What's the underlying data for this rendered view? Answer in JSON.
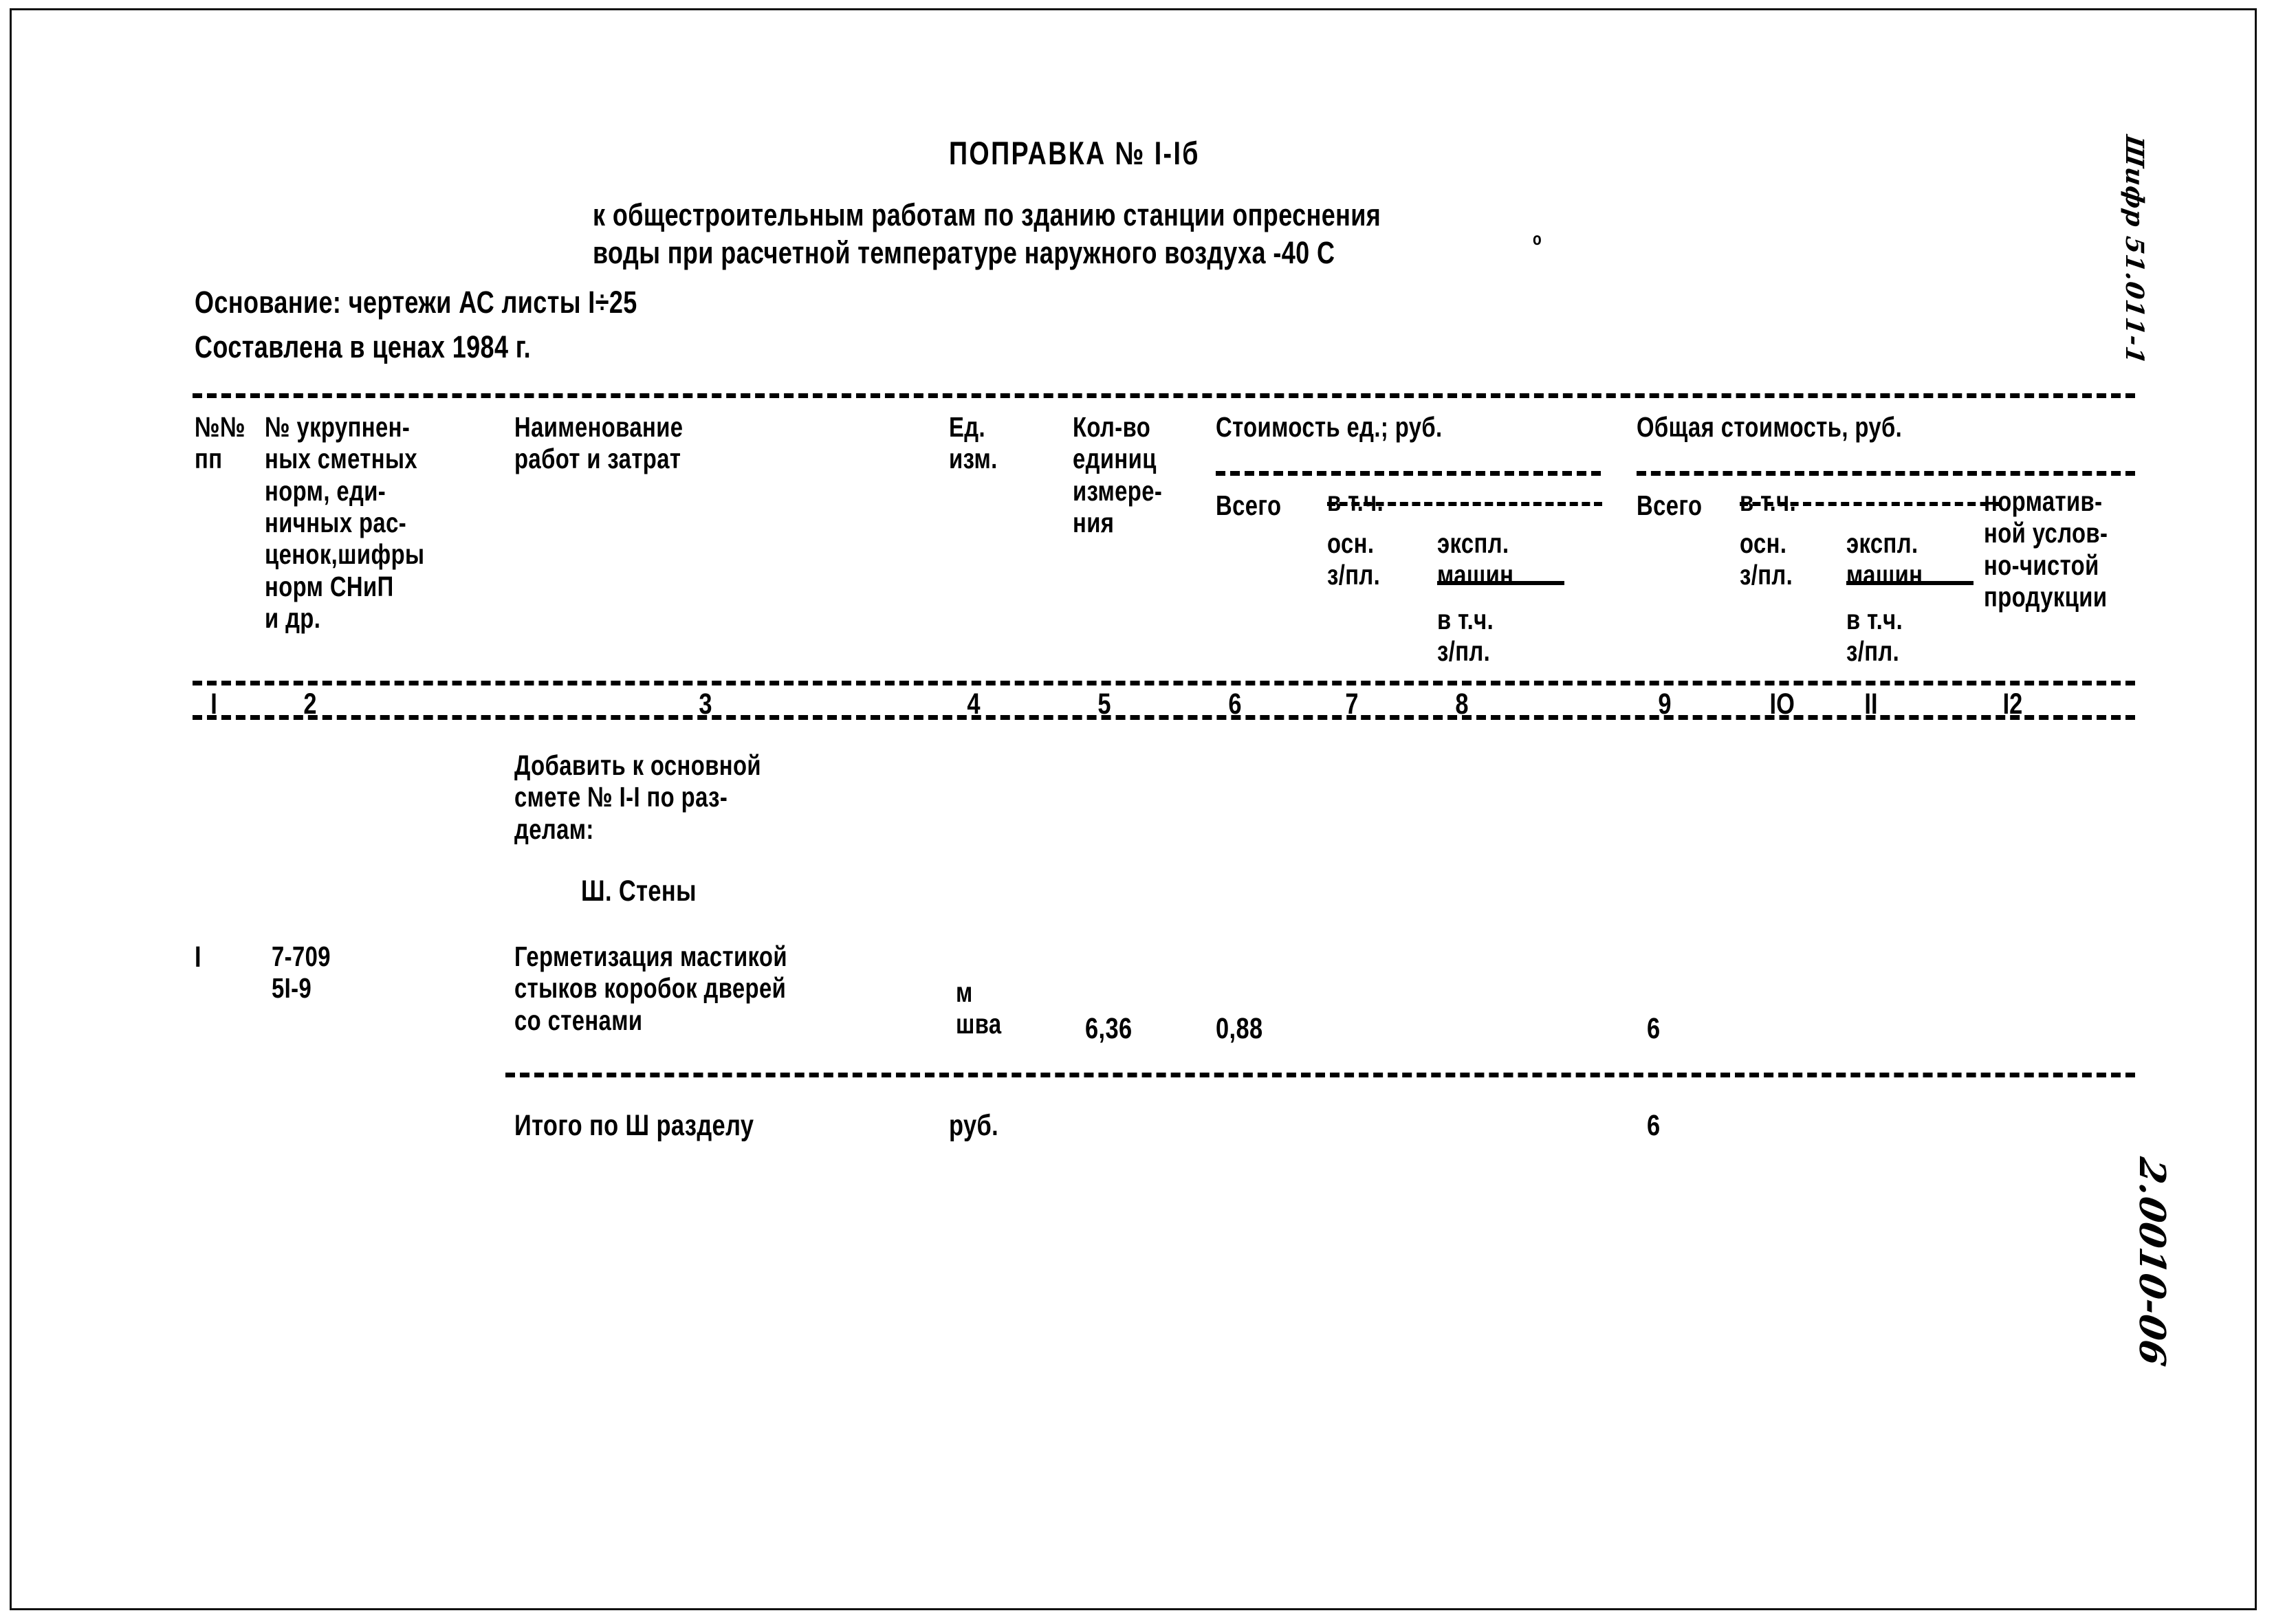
{
  "document": {
    "title": "ПОПРАВКА № I-Iб",
    "subtitle_line_1": "к общестроительным работам по зданию станции опреснения",
    "subtitle_line_2": "воды при расчетной температуре наружного воздуха -40 С",
    "degree_symbol": "о",
    "basis": "Основание: чертежи АС листы I÷25",
    "prices": "Составлена в ценах 1984 г."
  },
  "table": {
    "headers": {
      "col1": "№№\nпп",
      "col2": "№ укрупнен-\nных сметных\nнорм, еди-\nничных рас-\nценок,шифры\nнорм СНиП\nи др.",
      "col3": "Наименование\nработ и затрат",
      "col4": "Ед.\nизм.",
      "col5": "Кол-во\nединиц\nизмере-\nния",
      "cost_per_unit_group": "Стоимость ед.; руб.",
      "total_cost_group": "Общая стоимость, руб.",
      "vsego_unit": "Всего",
      "vtch_unit": "в т.ч.",
      "osn_zpl_unit": "осн.\nз/пл.",
      "expl_mashin_unit": "экспл.\nмашин",
      "vtch_zpl_unit": "в т.ч.\nз/пл.",
      "vsego_total": "Всего",
      "vtch_total": "в т.ч.",
      "osn_zpl_total": "осн.\nз/пл.",
      "expl_mashin_total": "экспл.\nмашин",
      "vtch_zpl_total": "в т.ч.\nз/пл.",
      "norm_chp": "норматив-\nной услов-\nно-чистой\nпродукции"
    },
    "column_numbers": [
      "I",
      "2",
      "3",
      "4",
      "5",
      "6",
      "7",
      "8",
      "9",
      "IO",
      "II",
      "I2"
    ],
    "column_number_x": [
      296,
      430,
      1005,
      1395,
      1585,
      1775,
      1945,
      2105,
      2400,
      2560,
      2700,
      2900
    ],
    "intro_note": "Добавить к основной\nсмете № I-I по раз-\nделам:",
    "section_heading": "Ш. Стены",
    "rows": [
      {
        "num": "I",
        "codes": "7-709\n5I-9",
        "description": "Герметизация мастикой\nстыков коробок дверей\nсо стенами",
        "unit": "м\nшва",
        "quantity": "6,36",
        "cost_unit_total": "0,88",
        "cost_unit_osn_zpl": "",
        "cost_unit_expl": "",
        "cost_unit_vtch_zpl": "",
        "total_vsego": "6",
        "total_osn_zpl": "",
        "total_expl": "",
        "total_vtch_zpl": "",
        "norm_chp": ""
      }
    ],
    "totals": {
      "label": "Итого по Ш разделу",
      "unit": "руб.",
      "value": "6"
    }
  },
  "margin_notes": {
    "top_right": "Шифр 51.011-1",
    "bottom_right": "2.0010-06"
  }
}
